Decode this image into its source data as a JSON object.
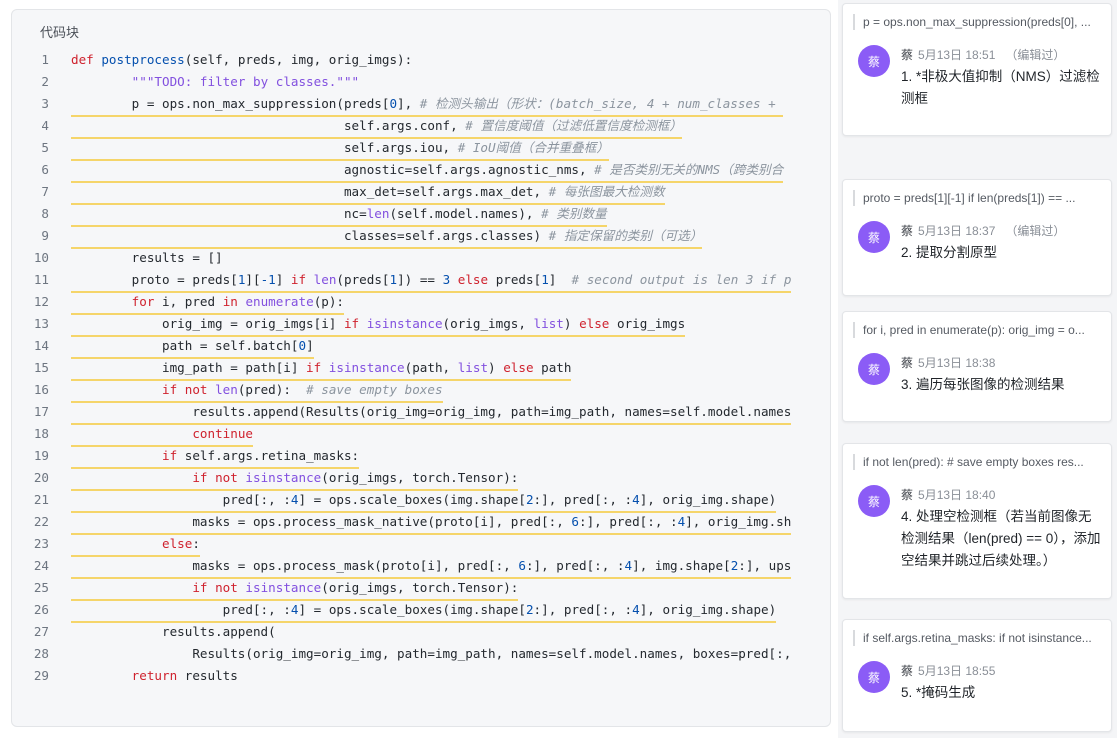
{
  "code_block": {
    "title": "代码块",
    "lines": [
      {
        "n": "1",
        "hl": false,
        "t": [
          [
            "kw",
            "def "
          ],
          [
            "fn",
            "postprocess"
          ],
          [
            "",
            "(self, preds, img, orig_imgs):"
          ]
        ]
      },
      {
        "n": "2",
        "hl": false,
        "t": [
          [
            "",
            "        "
          ],
          [
            "str",
            "\"\"\"TODO: filter by classes.\"\"\""
          ]
        ]
      },
      {
        "n": "3",
        "hl": true,
        "t": [
          [
            "",
            "        p = ops.non_max_suppression(preds["
          ],
          [
            "num",
            "0"
          ],
          [
            "",
            "], "
          ],
          [
            "cm",
            "# 检测头输出（形状：(batch_size, 4 + num_classes + "
          ]
        ]
      },
      {
        "n": "4",
        "hl": true,
        "t": [
          [
            "",
            "                                    self.args.conf, "
          ],
          [
            "cm",
            "# 置信度阈值（过滤低置信度检测框）"
          ]
        ]
      },
      {
        "n": "5",
        "hl": true,
        "t": [
          [
            "",
            "                                    self.args.iou, "
          ],
          [
            "cm",
            "# IoU阈值（合并重叠框）"
          ]
        ]
      },
      {
        "n": "6",
        "hl": true,
        "t": [
          [
            "",
            "                                    agnostic=self.args.agnostic_nms, "
          ],
          [
            "cm",
            "# 是否类别无关的NMS（跨类别合"
          ]
        ]
      },
      {
        "n": "7",
        "hl": true,
        "t": [
          [
            "",
            "                                    max_det=self.args.max_det, "
          ],
          [
            "cm",
            "# 每张图最大检测数"
          ]
        ]
      },
      {
        "n": "8",
        "hl": true,
        "t": [
          [
            "",
            "                                    nc="
          ],
          [
            "bi",
            "len"
          ],
          [
            "",
            "(self.model.names), "
          ],
          [
            "cm",
            "# 类别数量"
          ]
        ]
      },
      {
        "n": "9",
        "hl": true,
        "t": [
          [
            "",
            "                                    classes=self.args.classes) "
          ],
          [
            "cm",
            "# 指定保留的类别（可选）"
          ]
        ]
      },
      {
        "n": "10",
        "hl": false,
        "t": [
          [
            "",
            "        results = []"
          ]
        ]
      },
      {
        "n": "11",
        "hl": true,
        "t": [
          [
            "",
            "        proto = preds["
          ],
          [
            "num",
            "1"
          ],
          [
            "",
            "]["
          ],
          [
            "num",
            "-1"
          ],
          [
            "",
            "] "
          ],
          [
            "kw",
            "if "
          ],
          [
            "bi",
            "len"
          ],
          [
            "",
            "(preds["
          ],
          [
            "num",
            "1"
          ],
          [
            "",
            "]) == "
          ],
          [
            "num",
            "3"
          ],
          [
            "kw",
            " else "
          ],
          [
            "",
            "preds["
          ],
          [
            "num",
            "1"
          ],
          [
            "",
            "]  "
          ],
          [
            "cm",
            "# second output is len 3 if p"
          ]
        ]
      },
      {
        "n": "12",
        "hl": true,
        "t": [
          [
            "",
            "        "
          ],
          [
            "kw",
            "for "
          ],
          [
            "",
            "i, pred "
          ],
          [
            "kw",
            "in "
          ],
          [
            "bi",
            "enumerate"
          ],
          [
            "",
            "(p):"
          ]
        ]
      },
      {
        "n": "13",
        "hl": true,
        "t": [
          [
            "",
            "            orig_img = orig_imgs[i] "
          ],
          [
            "kw",
            "if "
          ],
          [
            "bi",
            "isinstance"
          ],
          [
            "",
            "(orig_imgs, "
          ],
          [
            "bi",
            "list"
          ],
          [
            "",
            ") "
          ],
          [
            "kw",
            "else "
          ],
          [
            "",
            "orig_imgs"
          ]
        ]
      },
      {
        "n": "14",
        "hl": true,
        "t": [
          [
            "",
            "            path = self.batch["
          ],
          [
            "num",
            "0"
          ],
          [
            "",
            "]"
          ]
        ]
      },
      {
        "n": "15",
        "hl": true,
        "t": [
          [
            "",
            "            img_path = path[i] "
          ],
          [
            "kw",
            "if "
          ],
          [
            "bi",
            "isinstance"
          ],
          [
            "",
            "(path, "
          ],
          [
            "bi",
            "list"
          ],
          [
            "",
            ") "
          ],
          [
            "kw",
            "else "
          ],
          [
            "",
            "path"
          ]
        ]
      },
      {
        "n": "16",
        "hl": true,
        "t": [
          [
            "",
            "            "
          ],
          [
            "kw",
            "if not "
          ],
          [
            "bi",
            "len"
          ],
          [
            "",
            "(pred):  "
          ],
          [
            "cm",
            "# save empty boxes"
          ]
        ]
      },
      {
        "n": "17",
        "hl": true,
        "t": [
          [
            "",
            "                results.append(Results(orig_img=orig_img, path=img_path, names=self.model.names"
          ]
        ]
      },
      {
        "n": "18",
        "hl": true,
        "t": [
          [
            "",
            "                "
          ],
          [
            "kw",
            "continue"
          ]
        ]
      },
      {
        "n": "19",
        "hl": true,
        "t": [
          [
            "",
            "            "
          ],
          [
            "kw",
            "if "
          ],
          [
            "",
            "self.args.retina_masks:"
          ]
        ]
      },
      {
        "n": "20",
        "hl": true,
        "t": [
          [
            "",
            "                "
          ],
          [
            "kw",
            "if not "
          ],
          [
            "bi",
            "isinstance"
          ],
          [
            "",
            "(orig_imgs, torch.Tensor):"
          ]
        ]
      },
      {
        "n": "21",
        "hl": true,
        "t": [
          [
            "",
            "                    pred[:, :"
          ],
          [
            "num",
            "4"
          ],
          [
            "",
            "] = ops.scale_boxes(img.shape["
          ],
          [
            "num",
            "2"
          ],
          [
            "",
            ":], pred[:, :"
          ],
          [
            "num",
            "4"
          ],
          [
            "",
            "], orig_img.shape)"
          ]
        ]
      },
      {
        "n": "22",
        "hl": true,
        "t": [
          [
            "",
            "                masks = ops.process_mask_native(proto[i], pred[:, "
          ],
          [
            "num",
            "6"
          ],
          [
            "",
            ":], pred[:, :"
          ],
          [
            "num",
            "4"
          ],
          [
            "",
            "], orig_img.sh"
          ]
        ]
      },
      {
        "n": "23",
        "hl": true,
        "t": [
          [
            "",
            "            "
          ],
          [
            "kw",
            "else"
          ],
          [
            "",
            ":"
          ]
        ]
      },
      {
        "n": "24",
        "hl": true,
        "t": [
          [
            "",
            "                masks = ops.process_mask(proto[i], pred[:, "
          ],
          [
            "num",
            "6"
          ],
          [
            "",
            ":], pred[:, :"
          ],
          [
            "num",
            "4"
          ],
          [
            "",
            "], img.shape["
          ],
          [
            "num",
            "2"
          ],
          [
            "",
            ":], ups"
          ]
        ]
      },
      {
        "n": "25",
        "hl": true,
        "t": [
          [
            "",
            "                "
          ],
          [
            "kw",
            "if not "
          ],
          [
            "bi",
            "isinstance"
          ],
          [
            "",
            "(orig_imgs, torch.Tensor):"
          ]
        ]
      },
      {
        "n": "26",
        "hl": true,
        "t": [
          [
            "",
            "                    pred[:, :"
          ],
          [
            "num",
            "4"
          ],
          [
            "",
            "] = ops.scale_boxes(img.shape["
          ],
          [
            "num",
            "2"
          ],
          [
            "",
            ":], pred[:, :"
          ],
          [
            "num",
            "4"
          ],
          [
            "",
            "], orig_img.shape)"
          ]
        ]
      },
      {
        "n": "27",
        "hl": false,
        "t": [
          [
            "",
            "            results.append("
          ]
        ]
      },
      {
        "n": "28",
        "hl": false,
        "t": [
          [
            "",
            "                Results(orig_img=orig_img, path=img_path, names=self.model.names, boxes=pred[:,"
          ]
        ]
      },
      {
        "n": "29",
        "hl": false,
        "t": [
          [
            "",
            "        "
          ],
          [
            "kw",
            "return "
          ],
          [
            "",
            "results"
          ]
        ]
      }
    ]
  },
  "comments": [
    {
      "snippet": "p = ops.non_max_suppression(preds[0], ...",
      "avatar": "蔡",
      "author": "蔡",
      "time": "5月13日 18:51",
      "edited": "（编辑过）",
      "body": "1. *非极大值抑制（NMS）过滤检测框"
    },
    {
      "snippet": "proto = preds[1][-1] if len(preds[1]) == ...",
      "avatar": "蔡",
      "author": "蔡",
      "time": "5月13日 18:37",
      "edited": "（编辑过）",
      "body": "2. 提取分割原型"
    },
    {
      "snippet": "for i, pred in enumerate(p): orig_img = o...",
      "avatar": "蔡",
      "author": "蔡",
      "time": "5月13日 18:38",
      "edited": "",
      "body": "3. 遍历每张图像的检测结果"
    },
    {
      "snippet": "if not len(pred): # save empty boxes res...",
      "avatar": "蔡",
      "author": "蔡",
      "time": "5月13日 18:40",
      "edited": "",
      "body": "4. 处理空检测框（若当前图像无检测结果（len(pred) == 0），添加空结果并跳过后续处理。）"
    },
    {
      "snippet": "if self.args.retina_masks: if not isinstance...",
      "avatar": "蔡",
      "author": "蔡",
      "time": "5月13日 18:55",
      "edited": "",
      "body": "5. *掩码生成"
    }
  ]
}
